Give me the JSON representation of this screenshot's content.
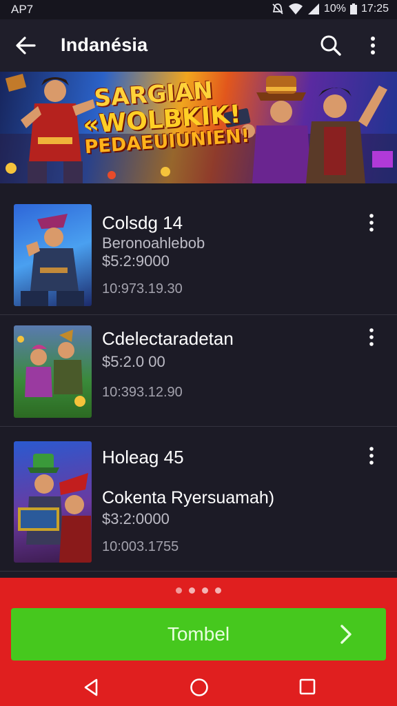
{
  "status_bar": {
    "carrier": "AP7",
    "battery": "10%",
    "time": "17:25"
  },
  "app_bar": {
    "title": "Indanésia",
    "icons": [
      "back-arrow-icon",
      "search-icon",
      "more-vertical-icon"
    ]
  },
  "banner": {
    "line1": "SARGIAN",
    "line2": "«WOLBKIK!",
    "line3": "PEDAEUIUNIEN!"
  },
  "items": [
    {
      "title": "Colsdg 14",
      "subtitle": "Beronoahlebob",
      "price": "$5:2:9000",
      "meta": "10:973.19.30"
    },
    {
      "title": "Cdelectaradetan",
      "price": "$5:2.0 00",
      "meta": "10:393.12.90"
    },
    {
      "title": "Holeag 45",
      "subtitle": "Cokenta Ryersuamah)",
      "price": "$3:2:0000",
      "meta": "10:003.1755"
    }
  ],
  "pager": {
    "count": 4,
    "active": 0
  },
  "primary_button": {
    "label": "Tombel"
  },
  "colors": {
    "background": "#1c1b26",
    "app_bar": "#1f1e2a",
    "bottom_panel": "#e01f1f",
    "primary_button": "#46c81e"
  }
}
